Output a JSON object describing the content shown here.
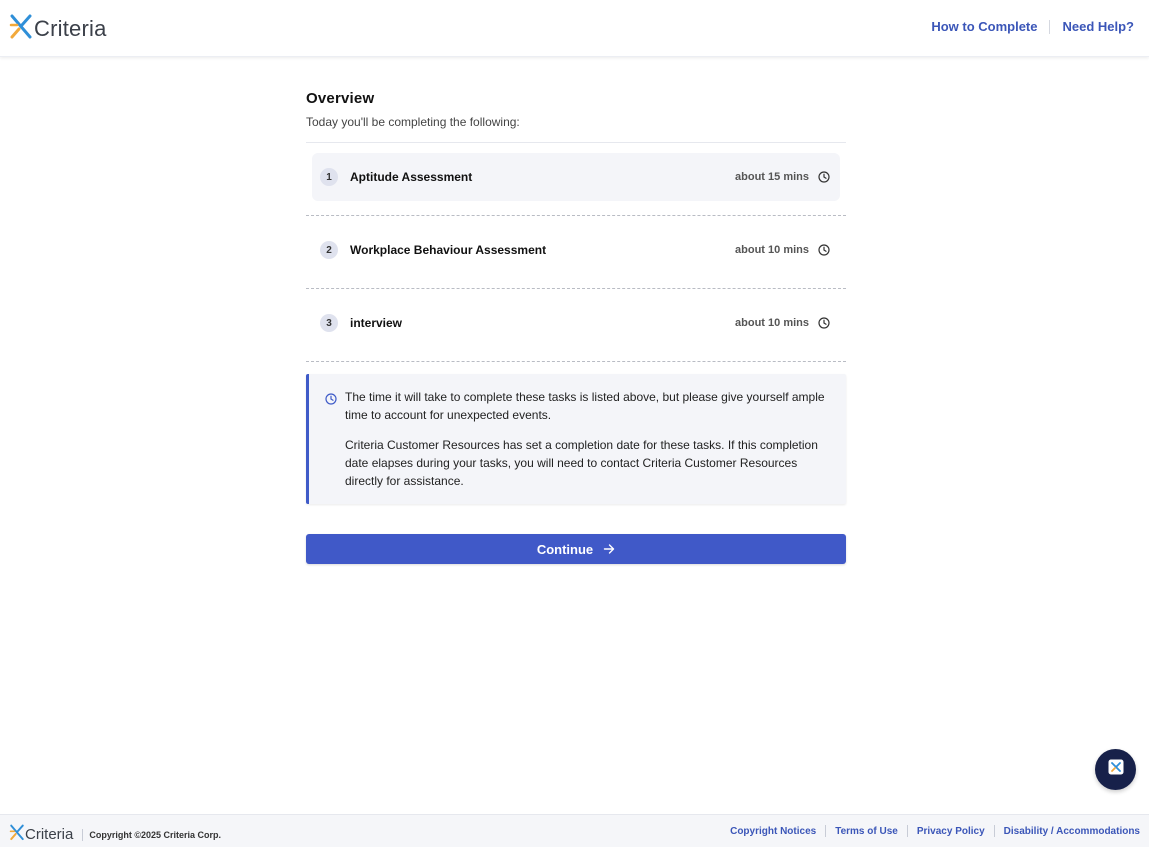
{
  "header": {
    "logo_text": "Criteria",
    "how_to_complete": "How to Complete",
    "need_help": "Need Help?"
  },
  "overview": {
    "title": "Overview",
    "subtitle": "Today you'll be completing the following:"
  },
  "tasks": [
    {
      "num": "1",
      "name": "Aptitude Assessment",
      "time": "about 15 mins"
    },
    {
      "num": "2",
      "name": "Workplace Behaviour Assessment",
      "time": "about 10 mins"
    },
    {
      "num": "3",
      "name": "interview",
      "time": "about 10 mins"
    }
  ],
  "info": {
    "paragraph1": "The time it will take to complete these tasks is listed above, but please give yourself ample time to account for unexpected events.",
    "paragraph2": "Criteria Customer Resources has set a completion date for these tasks. If this completion date elapses during your tasks, you will need to contact Criteria Customer Resources directly for assistance."
  },
  "continue_label": "Continue",
  "footer": {
    "logo_text": "Criteria",
    "copyright": "Copyright ©2025 Criteria Corp.",
    "links": [
      "Copyright Notices",
      "Terms of Use",
      "Privacy Policy",
      "Disability / Accommodations"
    ]
  },
  "colors": {
    "accent": "#4059c8",
    "link": "#3b56b8",
    "chat_button": "#17214a"
  },
  "icons": [
    "criteria-logo-icon",
    "clock-icon",
    "arrow-right-icon",
    "chat-icon"
  ]
}
